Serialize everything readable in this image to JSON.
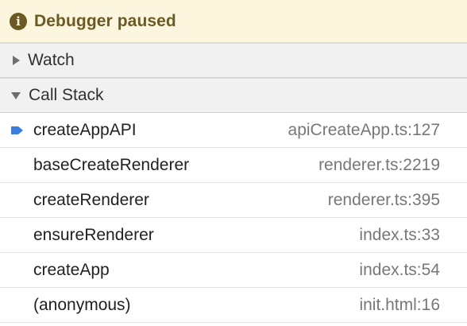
{
  "banner": {
    "icon": "info-icon",
    "text": "Debugger paused"
  },
  "watch": {
    "label": "Watch",
    "expanded": false
  },
  "call_stack": {
    "label": "Call Stack",
    "expanded": true,
    "frames": [
      {
        "function": "createAppAPI",
        "location": "apiCreateApp.ts:127",
        "current": true
      },
      {
        "function": "baseCreateRenderer",
        "location": "renderer.ts:2219",
        "current": false
      },
      {
        "function": "createRenderer",
        "location": "renderer.ts:395",
        "current": false
      },
      {
        "function": "ensureRenderer",
        "location": "index.ts:33",
        "current": false
      },
      {
        "function": "createApp",
        "location": "index.ts:54",
        "current": false
      },
      {
        "function": "(anonymous)",
        "location": "init.html:16",
        "current": false
      }
    ]
  },
  "colors": {
    "banner_bg": "#fbf6dd",
    "banner_text": "#6b5a24",
    "current_frame_arrow": "#3b7ddd"
  }
}
